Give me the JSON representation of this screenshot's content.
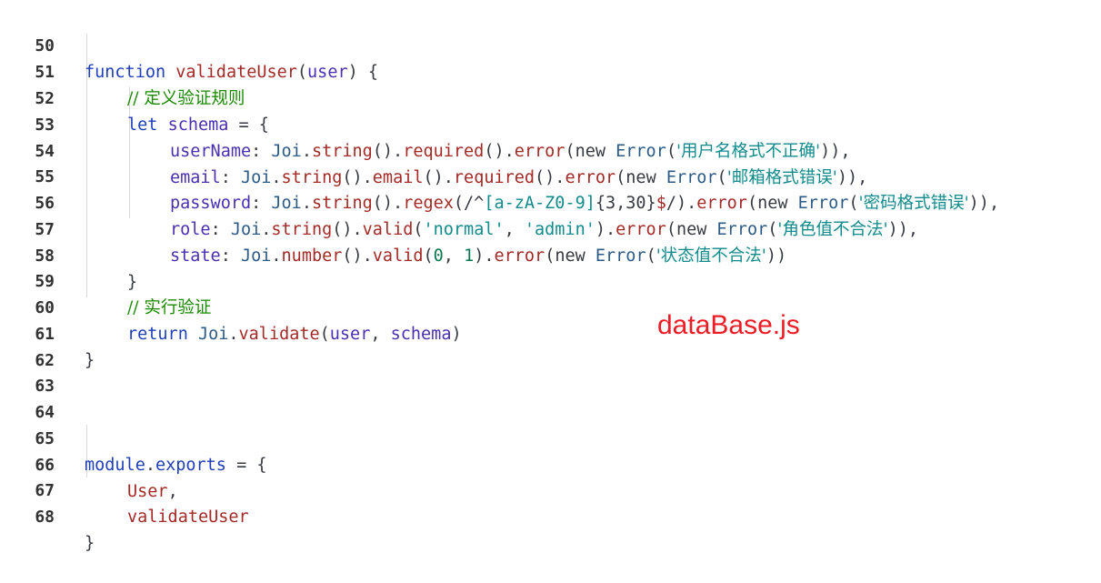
{
  "editor": {
    "filename_label": "dataBase.js",
    "line_numbers": [
      "50",
      "51",
      "52",
      "53",
      "54",
      "55",
      "56",
      "57",
      "58",
      "59",
      "60",
      "61",
      "62",
      "63",
      "64",
      "65",
      "66",
      "67",
      "68"
    ],
    "lines": {
      "l50": {
        "t1": "function",
        "t2": "validateUser",
        "t3": "(",
        "t4": "user",
        "t5": ") {"
      },
      "l51": {
        "comment": "// 定义验证规则"
      },
      "l52": {
        "t1": "let",
        "t2": "schema",
        "t3": " = {"
      },
      "l53": {
        "t1": "userName",
        "t2": ": ",
        "t3": "Joi",
        "t4": ".",
        "t5": "string",
        "t6": "().",
        "t7": "required",
        "t8": "().",
        "t9": "error",
        "t10": "(",
        "t11": "new",
        "t12": " Error",
        "t13": "(",
        "t14": "'用户名格式不正确'",
        "t15": ")),"
      },
      "l54": {
        "t1": "email",
        "t2": ": ",
        "t3": "Joi",
        "t4": ".",
        "t5": "string",
        "t6": "().",
        "t7": "email",
        "t8": "().",
        "t9": "required",
        "t10": "().",
        "t11": "error",
        "t12": "(",
        "t13": "new",
        "t14": " Error",
        "t15": "(",
        "t16": "'邮箱格式错误'",
        "t17": ")),"
      },
      "l55": {
        "t1": "password",
        "t2": ": ",
        "t3": "Joi",
        "t4": ".",
        "t5": "string",
        "t6": "().",
        "t7": "regex",
        "t8": "(/^",
        "t9": "[a-zA-Z0-9]",
        "t10": "{3,30}",
        "t11": "$",
        "t12": "/).",
        "t13": "error",
        "t14": "(",
        "t15": "new",
        "t16": " Error",
        "t17": "(",
        "t18": "'密码格式错误'",
        "t19": ")),"
      },
      "l56": {
        "t1": "role",
        "t2": ": ",
        "t3": "Joi",
        "t4": ".",
        "t5": "string",
        "t6": "().",
        "t7": "valid",
        "t8": "(",
        "t9": "'normal'",
        "t10": ", ",
        "t11": "'admin'",
        "t12": ").",
        "t13": "error",
        "t14": "(",
        "t15": "new",
        "t16": " Error",
        "t17": "(",
        "t18": "'角色值不合法'",
        "t19": ")),"
      },
      "l57": {
        "t1": "state",
        "t2": ": ",
        "t3": "Joi",
        "t4": ".",
        "t5": "number",
        "t6": "().",
        "t7": "valid",
        "t8": "(",
        "t9": "0",
        "t10": ", ",
        "t11": "1",
        "t12": ").",
        "t13": "error",
        "t14": "(",
        "t15": "new",
        "t16": " Error",
        "t17": "(",
        "t18": "'状态值不合法'",
        "t19": "))"
      },
      "l58": {
        "t1": "}"
      },
      "l59": {
        "comment": "// 实行验证"
      },
      "l60": {
        "t1": "return",
        "t2": " Joi",
        "t3": ".",
        "t4": "validate",
        "t5": "(",
        "t6": "user",
        "t7": ", ",
        "t8": "schema",
        "t9": ")"
      },
      "l61": {
        "t1": "}"
      },
      "l65": {
        "t1": "module",
        "t2": ".",
        "t3": "exports",
        "t4": " = {"
      },
      "l66": {
        "t1": "User",
        "t2": ","
      },
      "l67": {
        "t1": "validateUser"
      },
      "l68": {
        "t1": "}"
      }
    }
  },
  "colors": {
    "keyword": "#1f3fb8",
    "function": "#a32a26",
    "property": "#4a2fb0",
    "comment": "#1a8a00",
    "string": "#118b8b",
    "label": "#ee1c25"
  }
}
